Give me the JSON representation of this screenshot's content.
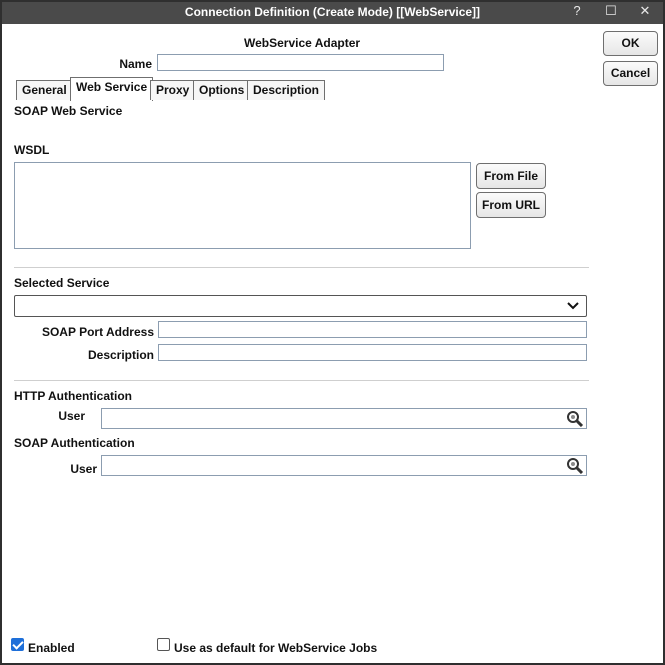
{
  "window": {
    "title": "Connection Definition (Create Mode) [[WebService]]",
    "controls": [
      "?",
      "☐",
      "✕"
    ]
  },
  "header": {
    "adapter_title": "WebService Adapter",
    "name_label": "Name",
    "name_value": ""
  },
  "actions": {
    "ok_label": "OK",
    "cancel_label": "Cancel"
  },
  "tabs": [
    {
      "label": "General",
      "active": false
    },
    {
      "label": "Web Service",
      "active": true
    },
    {
      "label": "Proxy",
      "active": false
    },
    {
      "label": "Options",
      "active": false
    },
    {
      "label": "Description",
      "active": false
    }
  ],
  "soap": {
    "section_title": "SOAP Web Service",
    "wsdl_label": "WSDL",
    "wsdl_value": "",
    "from_file_label": "From File",
    "from_url_label": "From URL"
  },
  "service": {
    "selected_label": "Selected Service",
    "selected_value": "",
    "port_label": "SOAP Port Address",
    "port_value": "",
    "description_label": "Description",
    "description_value": ""
  },
  "http_auth": {
    "title": "HTTP Authentication",
    "user_label": "User",
    "user_value": ""
  },
  "soap_auth": {
    "title": "SOAP Authentication",
    "user_label": "User",
    "user_value": ""
  },
  "footer": {
    "enabled_label": "Enabled",
    "enabled_checked": true,
    "default_label": "Use as default for WebService Jobs",
    "default_checked": false
  },
  "icons": {
    "search": "magnifier-icon",
    "dropdown": "chevron-down-icon",
    "resize": "resize-grip-icon"
  },
  "colors": {
    "titlebar": "#4a4a4a",
    "checkbox": "#1e6fd9",
    "field_border": "#8c9db0"
  }
}
